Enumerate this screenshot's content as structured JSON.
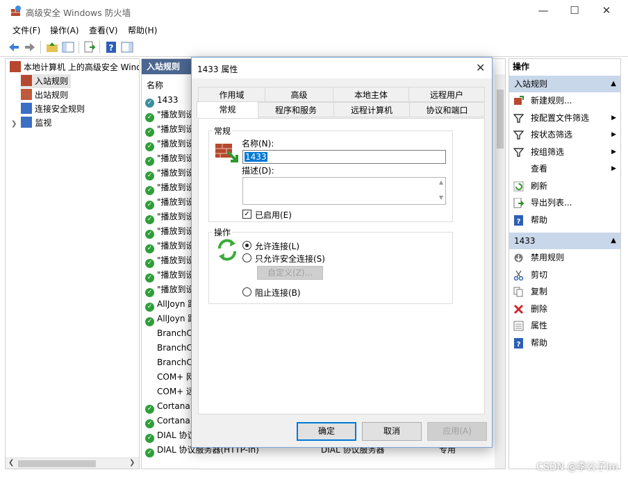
{
  "window": {
    "title": "高级安全 Windows 防火墙"
  },
  "menu": [
    "文件(F)",
    "操作(A)",
    "查看(V)",
    "帮助(H)"
  ],
  "tree": {
    "root": "本地计算机 上的高级安全 Wind",
    "items": [
      "入站规则",
      "出站规则",
      "连接安全规则",
      "监视"
    ]
  },
  "list": {
    "header": "入站规则",
    "column_name": "名称",
    "rows": [
      "1433",
      "\"播放到设",
      "\"播放到设",
      "\"播放到设",
      "\"播放到设",
      "\"播放到设",
      "\"播放到设",
      "\"播放到设",
      "\"播放到设",
      "\"播放到设",
      "\"播放到设",
      "\"播放到设",
      "\"播放到设",
      "\"播放到设",
      "AllJoyn 路",
      "AllJoyn 路",
      "BranchC",
      "BranchC",
      "BranchC",
      "COM+ 网",
      "COM+ 远",
      "Cortana",
      "Cortana",
      "DIAL 协议"
    ],
    "last_row": {
      "name": "DIAL 协议服务器(HTTP-In)",
      "group": "DIAL 协议服务器",
      "profile": "专用"
    }
  },
  "actions": {
    "header": "操作",
    "section1": "入站规则",
    "section1_items": [
      "新建规则...",
      "按配置文件筛选",
      "按状态筛选",
      "按组筛选",
      "查看",
      "刷新",
      "导出列表...",
      "帮助"
    ],
    "section2": "1433",
    "section2_items": [
      "禁用规则",
      "剪切",
      "复制",
      "删除",
      "属性",
      "帮助"
    ]
  },
  "dialog": {
    "title": "1433 属性",
    "tabs_row1": [
      "作用域",
      "高级",
      "本地主体",
      "远程用户"
    ],
    "tabs_row2": [
      "常规",
      "程序和服务",
      "远程计算机",
      "协议和端口"
    ],
    "general_group": "常规",
    "name_label": "名称(N):",
    "name_value": "1433",
    "desc_label": "描述(D):",
    "enabled_label": "已启用(E)",
    "action_group": "操作",
    "allow_label": "允许连接(L)",
    "allow_secure_label": "只允许安全连接(S)",
    "customize_label": "自定义(Z)...",
    "block_label": "阻止连接(B)",
    "ok": "确定",
    "cancel": "取消",
    "apply": "应用(A)"
  },
  "watermark": "CSDN @李公子lm"
}
